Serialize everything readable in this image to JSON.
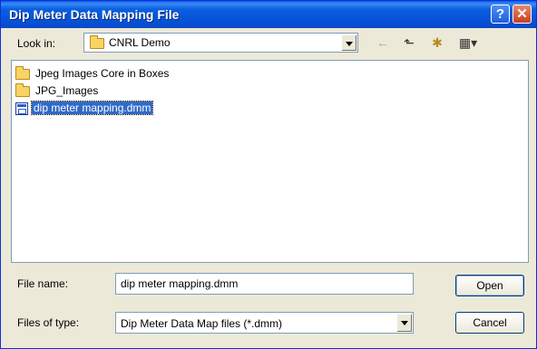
{
  "window": {
    "title": "Dip Meter Data Mapping File",
    "help_glyph": "?",
    "close_glyph": "✕"
  },
  "toolbar": {
    "look_in_label": "Look in:",
    "look_in_value": "CNRL Demo",
    "back_glyph": "←",
    "up_glyph": "⬑",
    "newfolder_glyph": "✱",
    "views_glyph": "▦▾"
  },
  "files": [
    {
      "name": "Jpeg Images Core in Boxes",
      "type": "folder",
      "selected": false
    },
    {
      "name": "JPG_Images",
      "type": "folder",
      "selected": false
    },
    {
      "name": "dip meter mapping.dmm",
      "type": "file",
      "selected": true
    }
  ],
  "form": {
    "filename_label": "File name:",
    "filename_value": "dip meter mapping.dmm",
    "filetype_label": "Files of type:",
    "filetype_value": "Dip Meter Data Map files (*.dmm)"
  },
  "buttons": {
    "open": "Open",
    "cancel": "Cancel"
  }
}
